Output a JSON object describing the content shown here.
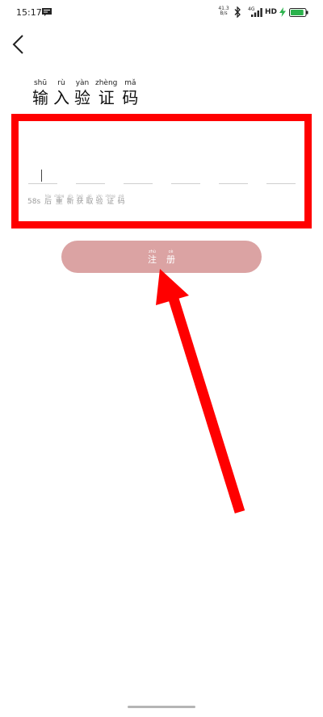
{
  "status_bar": {
    "time": "15:17",
    "net_speed_value": "41.3",
    "net_speed_unit": "B/s",
    "signal_label": "4G",
    "hd_label": "HD",
    "battery_level": 0.9
  },
  "header": {
    "title": [
      {
        "pinyin": "shū",
        "char": "输"
      },
      {
        "pinyin": "rù",
        "char": "入"
      },
      {
        "pinyin": "yàn",
        "char": "验"
      },
      {
        "pinyin": "zhèng",
        "char": "证"
      },
      {
        "pinyin": "mǎ",
        "char": "码"
      }
    ]
  },
  "code_input": {
    "slot_count": 6,
    "countdown": "58s",
    "resend": [
      {
        "pinyin": "hòu",
        "char": "后"
      },
      {
        "pinyin": "chóng",
        "char": "重"
      },
      {
        "pinyin": "xīn",
        "char": "新"
      },
      {
        "pinyin": "huò",
        "char": "获"
      },
      {
        "pinyin": "qǔ",
        "char": "取"
      },
      {
        "pinyin": "yàn",
        "char": "验"
      },
      {
        "pinyin": "zhèng",
        "char": "证"
      },
      {
        "pinyin": "mǎ",
        "char": "码"
      }
    ]
  },
  "register_button": {
    "label": [
      {
        "pinyin": "zhù",
        "char": "注"
      },
      {
        "pinyin": "cè",
        "char": "册"
      }
    ]
  },
  "colors": {
    "highlight": "#ff0000",
    "button": "#dba3a3"
  },
  "icons": [
    "message-icon",
    "bluetooth-icon",
    "signal-icon",
    "charging-icon",
    "battery-icon",
    "back-arrow-icon"
  ]
}
